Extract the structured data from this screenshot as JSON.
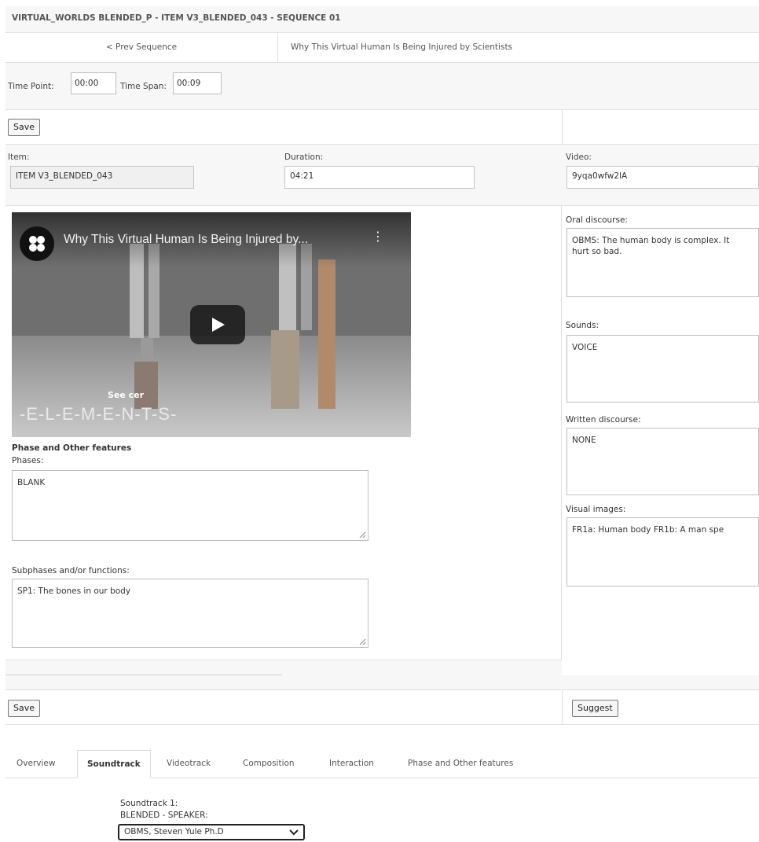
{
  "header": {
    "title": "VIRTUAL_WORLDS BLENDED_P - ITEM V3_BLENDED_043 - SEQUENCE 01"
  },
  "nav": {
    "prev_label": "< Prev Sequence",
    "sequence_title": "Why This Virtual Human Is Being Injured by Scientists"
  },
  "time": {
    "point_label": "Time Point:",
    "point_value": "00:00",
    "span_label": "Time Span:",
    "span_value": "00:09"
  },
  "buttons": {
    "save": "Save",
    "suggest": "Suggest"
  },
  "fields": {
    "item_label": "Item:",
    "item_value": "ITEM V3_BLENDED_043",
    "duration_label": "Duration:",
    "duration_value": "04:21",
    "video_label": "Video:",
    "video_value": "9yqa0wfw2lA"
  },
  "video_player": {
    "title": "Why This Virtual Human Is Being Injured by...",
    "overlay_text": "See cer",
    "brand_text": "-E-L-E-M-E-N-T-S-"
  },
  "left": {
    "section_title": "Phase and Other features",
    "phases_label": "Phases:",
    "phases_value": "BLANK",
    "subphases_label": "Subphases and/or functions:",
    "subphases_value": "SP1: The bones in our body"
  },
  "right": {
    "oral_label": "Oral discourse:",
    "oral_value": "OBMS: The human body is complex. It\nhurt so bad.",
    "sounds_label": "Sounds:",
    "sounds_value": "VOICE",
    "written_label": "Written discourse:",
    "written_value": "NONE",
    "visual_label": "Visual images:",
    "visual_value": "FR1a: Human body   FR1b: A man spe"
  },
  "tabs": [
    {
      "label": "Overview"
    },
    {
      "label": "Soundtrack"
    },
    {
      "label": "Videotrack"
    },
    {
      "label": "Composition"
    },
    {
      "label": "Interaction"
    },
    {
      "label": "Phase and Other features"
    }
  ],
  "soundtrack": {
    "title": "Soundtrack 1:",
    "sub": "BLENDED - SPEAKER:",
    "selected": "OBMS, Steven Yule Ph.D"
  },
  "colors": {
    "panel_bg": "#f7f7f7",
    "border": "#e0e0e0"
  }
}
